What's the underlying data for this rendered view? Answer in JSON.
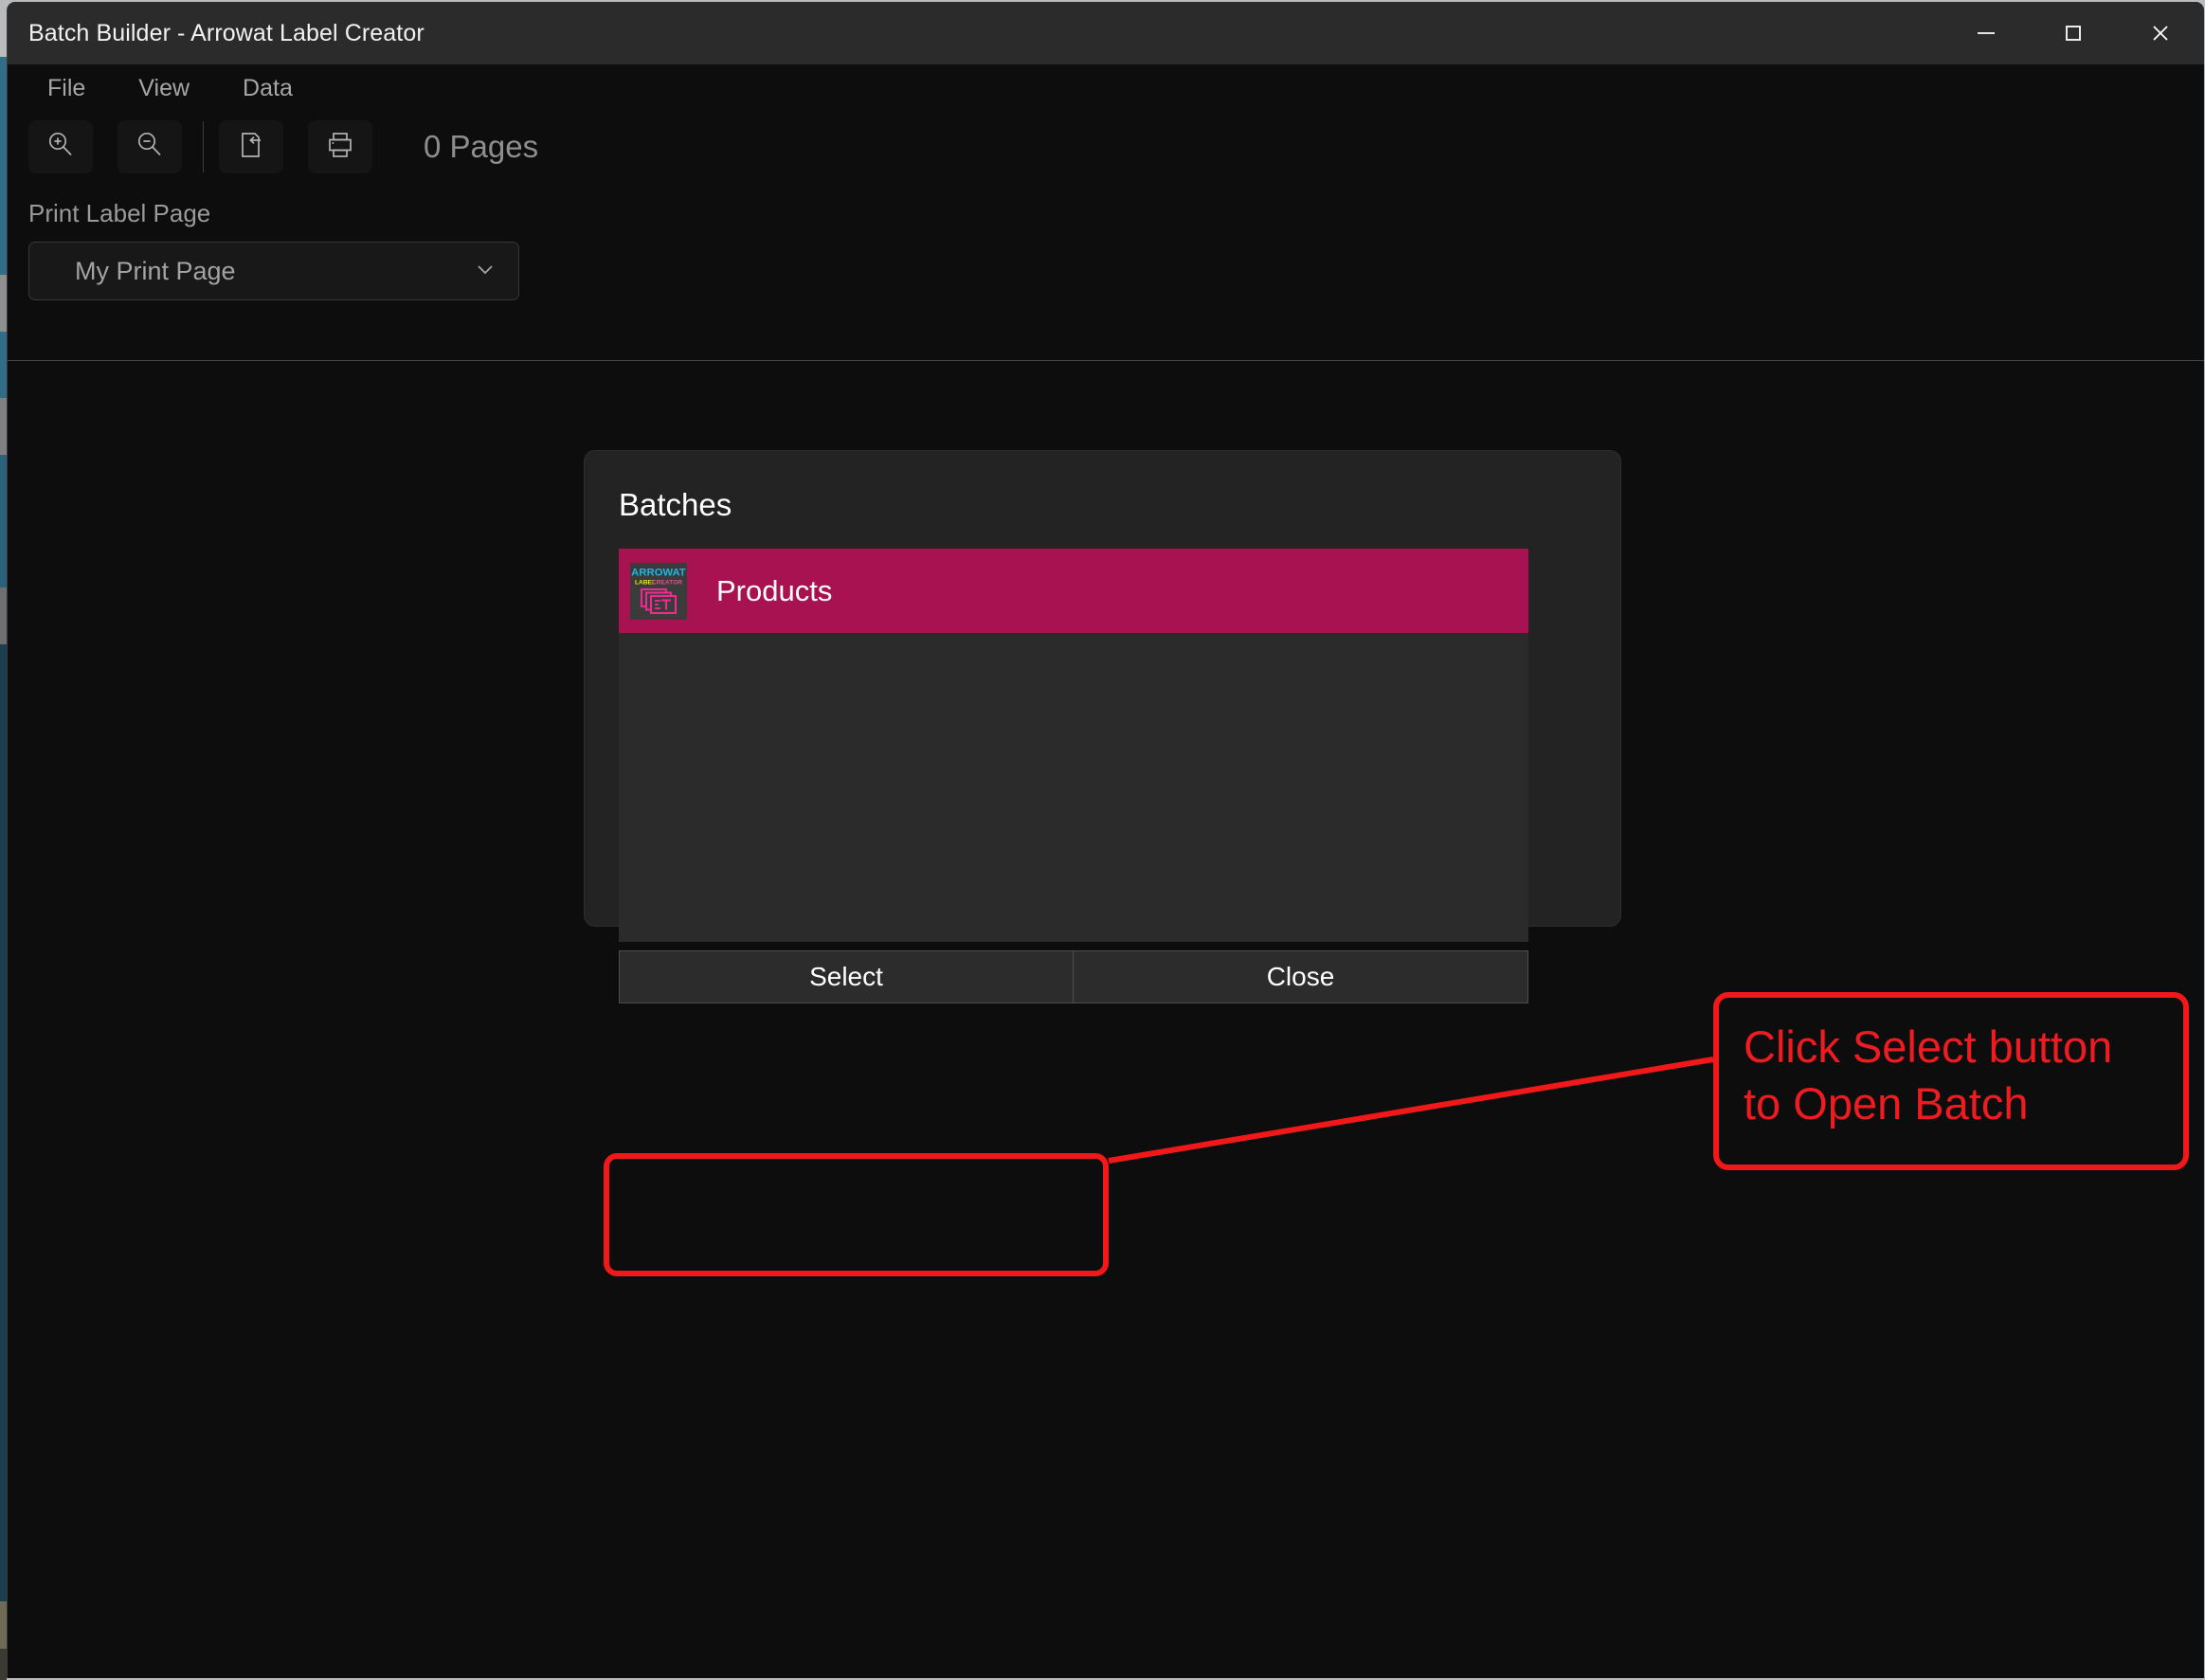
{
  "window": {
    "title": "Batch Builder - Arrowat Label Creator",
    "controls": [
      {
        "name": "minimize",
        "glyph": "minimize-icon"
      },
      {
        "name": "maximize",
        "glyph": "maximize-icon"
      },
      {
        "name": "close",
        "glyph": "close-icon"
      }
    ]
  },
  "menubar": {
    "items": [
      {
        "label": "File"
      },
      {
        "label": "View"
      },
      {
        "label": "Data"
      }
    ]
  },
  "toolbar": {
    "buttons": [
      {
        "name": "zoom-in-icon",
        "tooltip": "Zoom In"
      },
      {
        "name": "zoom-out-icon",
        "tooltip": "Zoom Out"
      },
      {
        "name": "export-page-icon",
        "tooltip": "Export Page"
      },
      {
        "name": "print-icon",
        "tooltip": "Print"
      }
    ],
    "pages_status": "0 Pages"
  },
  "print_section": {
    "label": "Print Label Page",
    "dropdown": {
      "value": "My Print Page",
      "chevron": "chevron-down-icon"
    }
  },
  "dialog": {
    "title": "Batches",
    "items": [
      {
        "label": "Products",
        "selected": true,
        "icon": {
          "name": "arrowat-label-creator-icon",
          "line1": "ARROWAT",
          "line2a": "LABEL",
          "line2b": "CREATOR",
          "letter": "T"
        }
      }
    ],
    "buttons": [
      {
        "label": "Select",
        "highlighted": true
      },
      {
        "label": "Close",
        "highlighted": false
      }
    ]
  },
  "annotation": {
    "text": "Click Select button\nto Open Batch",
    "color": "#ee1b20",
    "target": "Select"
  },
  "colors": {
    "accent_selection": "#a81250",
    "window_background": "#0d0d0d",
    "titlebar": "#2b2b2b",
    "dialog_background": "#232323",
    "list_background": "#2b2b2b",
    "annotation_red": "#f01818",
    "icon_cyan": "#1fb6e6",
    "icon_yellow": "#e8e80f",
    "icon_pink": "#ec2a8f"
  }
}
